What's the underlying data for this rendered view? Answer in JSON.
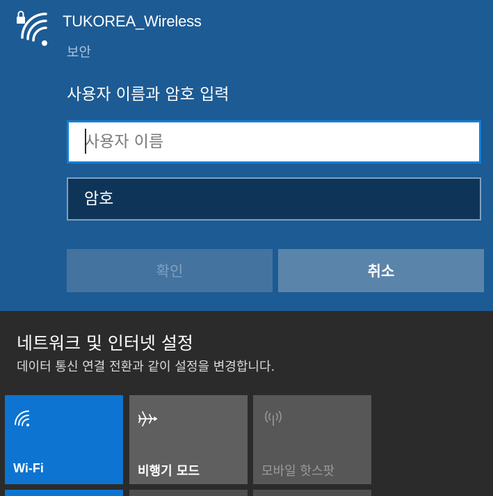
{
  "network": {
    "name": "TUKOREA_Wireless",
    "status": "보안",
    "prompt": "사용자 이름과 암호 입력"
  },
  "fields": {
    "username_placeholder": "사용자 이름",
    "password_placeholder": "암호"
  },
  "buttons": {
    "confirm_label": "확인",
    "cancel_label": "취소"
  },
  "settings": {
    "title": "네트워크 및 인터넷 설정",
    "subtitle": "데이터 통신 연결 전환과 같이 설정을 변경합니다."
  },
  "quick_actions": [
    {
      "label": "Wi-Fi",
      "icon": "wifi-icon",
      "state": "on"
    },
    {
      "label": "비행기 모드",
      "icon": "airplane-icon",
      "state": "off"
    },
    {
      "label": "모바일 핫스팟",
      "icon": "hotspot-icon",
      "state": "disabled"
    }
  ],
  "colors": {
    "panel_bg": "#1d5b94",
    "accent": "#0d74d1",
    "flyout_bg": "#2b2b2b"
  }
}
